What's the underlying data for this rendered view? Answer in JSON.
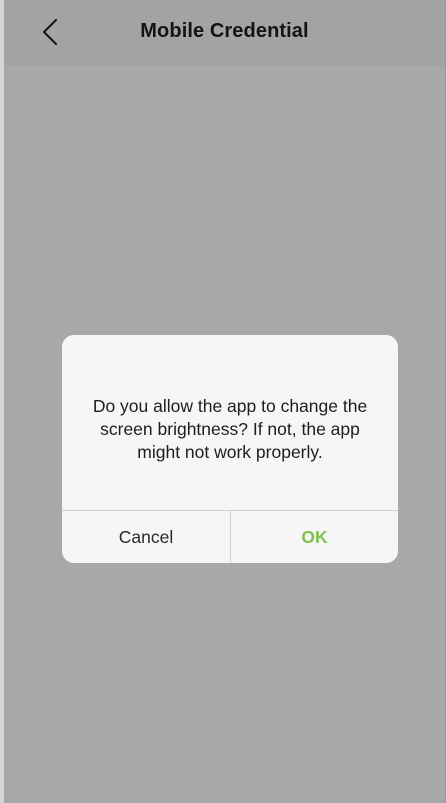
{
  "header": {
    "back_icon": "chevron-left-icon",
    "title": "Mobile Credential"
  },
  "dialog": {
    "message": "Do you allow the app to change the screen brightness? If not, the app might not work properly.",
    "cancel_label": "Cancel",
    "ok_label": "OK",
    "ok_color": "#7dc24a"
  },
  "colors": {
    "overlay_background": "#a8a8a8",
    "dialog_background": "#f6f6f6"
  }
}
